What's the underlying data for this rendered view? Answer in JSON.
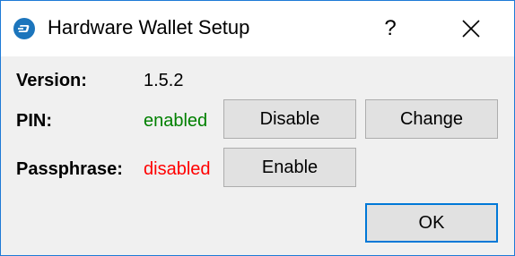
{
  "window": {
    "title": "Hardware Wallet Setup",
    "help_label": "?",
    "app_icon": "dash-logo-icon",
    "close_icon": "close-icon"
  },
  "fields": {
    "version": {
      "label": "Version:",
      "value": "1.5.2"
    },
    "pin": {
      "label": "PIN:",
      "value": "enabled",
      "value_color": "#008000"
    },
    "passphrase": {
      "label": "Passphrase:",
      "value": "disabled",
      "value_color": "#ff0000"
    }
  },
  "buttons": {
    "disable": "Disable",
    "change": "Change",
    "enable": "Enable",
    "ok": "OK"
  },
  "colors": {
    "accent": "#0078d7",
    "border": "#1e7ad6",
    "enabled": "#008000",
    "disabled": "#ff0000"
  }
}
